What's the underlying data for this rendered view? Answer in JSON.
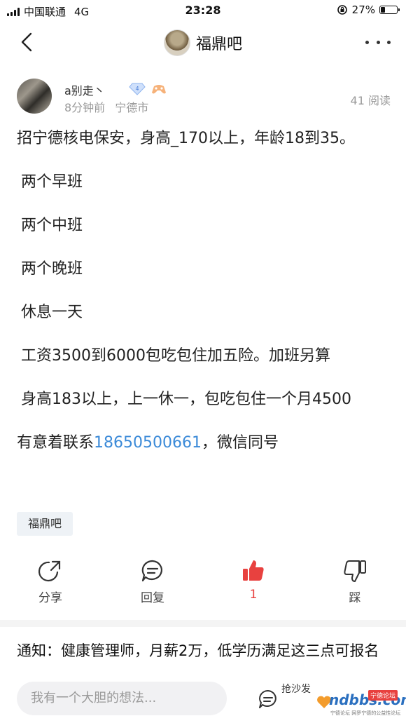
{
  "status_bar": {
    "carrier": "中国联通",
    "network": "4G",
    "time": "23:28",
    "battery": "27%",
    "battery_level": 0.27
  },
  "header": {
    "forum_name": "福鼎吧"
  },
  "author": {
    "name": "a别走丶",
    "level": "4",
    "time_ago": "8分钟前",
    "location": "宁德市",
    "read_count": "41 阅读"
  },
  "post": {
    "line1": "招宁德核电保安，身高_170以上，年龄18到35。",
    "line2": "两个早班",
    "line3": "两个中班",
    "line4": "两个晚班",
    "line5": "休息一天",
    "line6": "工资3500到6000包吃包住加五险。加班另算",
    "line7": "身高183以上，上一休一，包吃包住一个月4500",
    "contact_prefix": "有意着联系",
    "contact_phone": "18650500661",
    "contact_suffix": "，微信同号",
    "tag": "福鼎吧"
  },
  "actions": {
    "share": "分享",
    "reply": "回复",
    "like_count": "1",
    "dislike": "踩"
  },
  "notice": {
    "text": "通知：健康管理师，月薪2万，低学历满足这三点可报名"
  },
  "bottom_bar": {
    "reply_placeholder": "我有一个大胆的想法...",
    "sofa_label": "抢沙发"
  },
  "watermark": {
    "text": "ndbbs.com",
    "tag": "宁德论坛",
    "sub": "宁德论坛 网罗宁德的公益性论坛"
  },
  "colors": {
    "accent_red": "#e8413f",
    "link_blue": "#3b8ad8"
  }
}
